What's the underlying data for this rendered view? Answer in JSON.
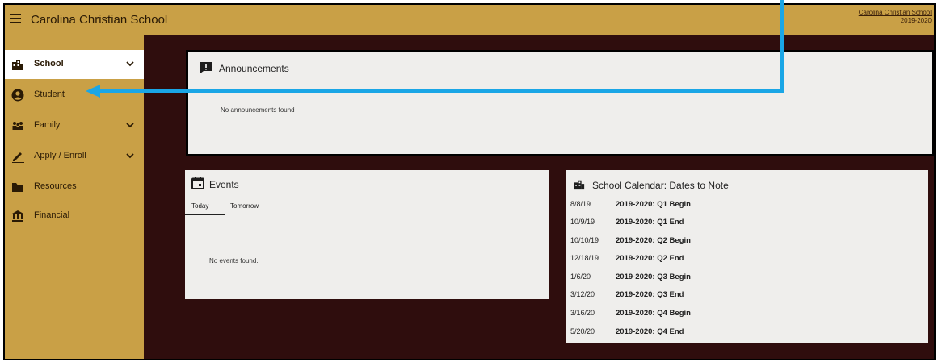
{
  "header": {
    "title": "Carolina Christian School",
    "school_link": "Carolina Christian School",
    "school_year": "2019-2020"
  },
  "sidebar": {
    "items": [
      {
        "label": "School",
        "icon": "building-icon",
        "has_chevron": true,
        "active": true
      },
      {
        "label": "Student",
        "icon": "user-circle-icon",
        "has_chevron": false,
        "active": false
      },
      {
        "label": "Family",
        "icon": "family-icon",
        "has_chevron": true,
        "active": false
      },
      {
        "label": "Apply / Enroll",
        "icon": "pencil-icon",
        "has_chevron": true,
        "active": false
      },
      {
        "label": "Resources",
        "icon": "folder-icon",
        "has_chevron": false,
        "active": false
      },
      {
        "label": "Financial",
        "icon": "bank-icon",
        "has_chevron": false,
        "active": false
      }
    ]
  },
  "announcements": {
    "title": "Announcements",
    "empty_text": "No announcements found"
  },
  "events": {
    "title": "Events",
    "tabs": [
      "Today",
      "Tomorrow"
    ],
    "empty_text": "No events found."
  },
  "calendar": {
    "title": "School Calendar: Dates to Note",
    "rows": [
      {
        "date": "8/8/19",
        "event": "2019-2020: Q1 Begin"
      },
      {
        "date": "10/9/19",
        "event": "2019-2020: Q1 End"
      },
      {
        "date": "10/10/19",
        "event": "2019-2020: Q2 Begin"
      },
      {
        "date": "12/18/19",
        "event": "2019-2020: Q2 End"
      },
      {
        "date": "1/6/20",
        "event": "2019-2020: Q3 Begin"
      },
      {
        "date": "3/12/20",
        "event": "2019-2020: Q3 End"
      },
      {
        "date": "3/16/20",
        "event": "2019-2020: Q4 Begin"
      },
      {
        "date": "5/20/20",
        "event": "2019-2020: Q4 End"
      }
    ]
  },
  "colors": {
    "header_bg": "#c9a046",
    "content_bg": "#2f0d0d",
    "panel_bg": "#efeeec",
    "annotation_arrow": "#1aa6e6"
  }
}
